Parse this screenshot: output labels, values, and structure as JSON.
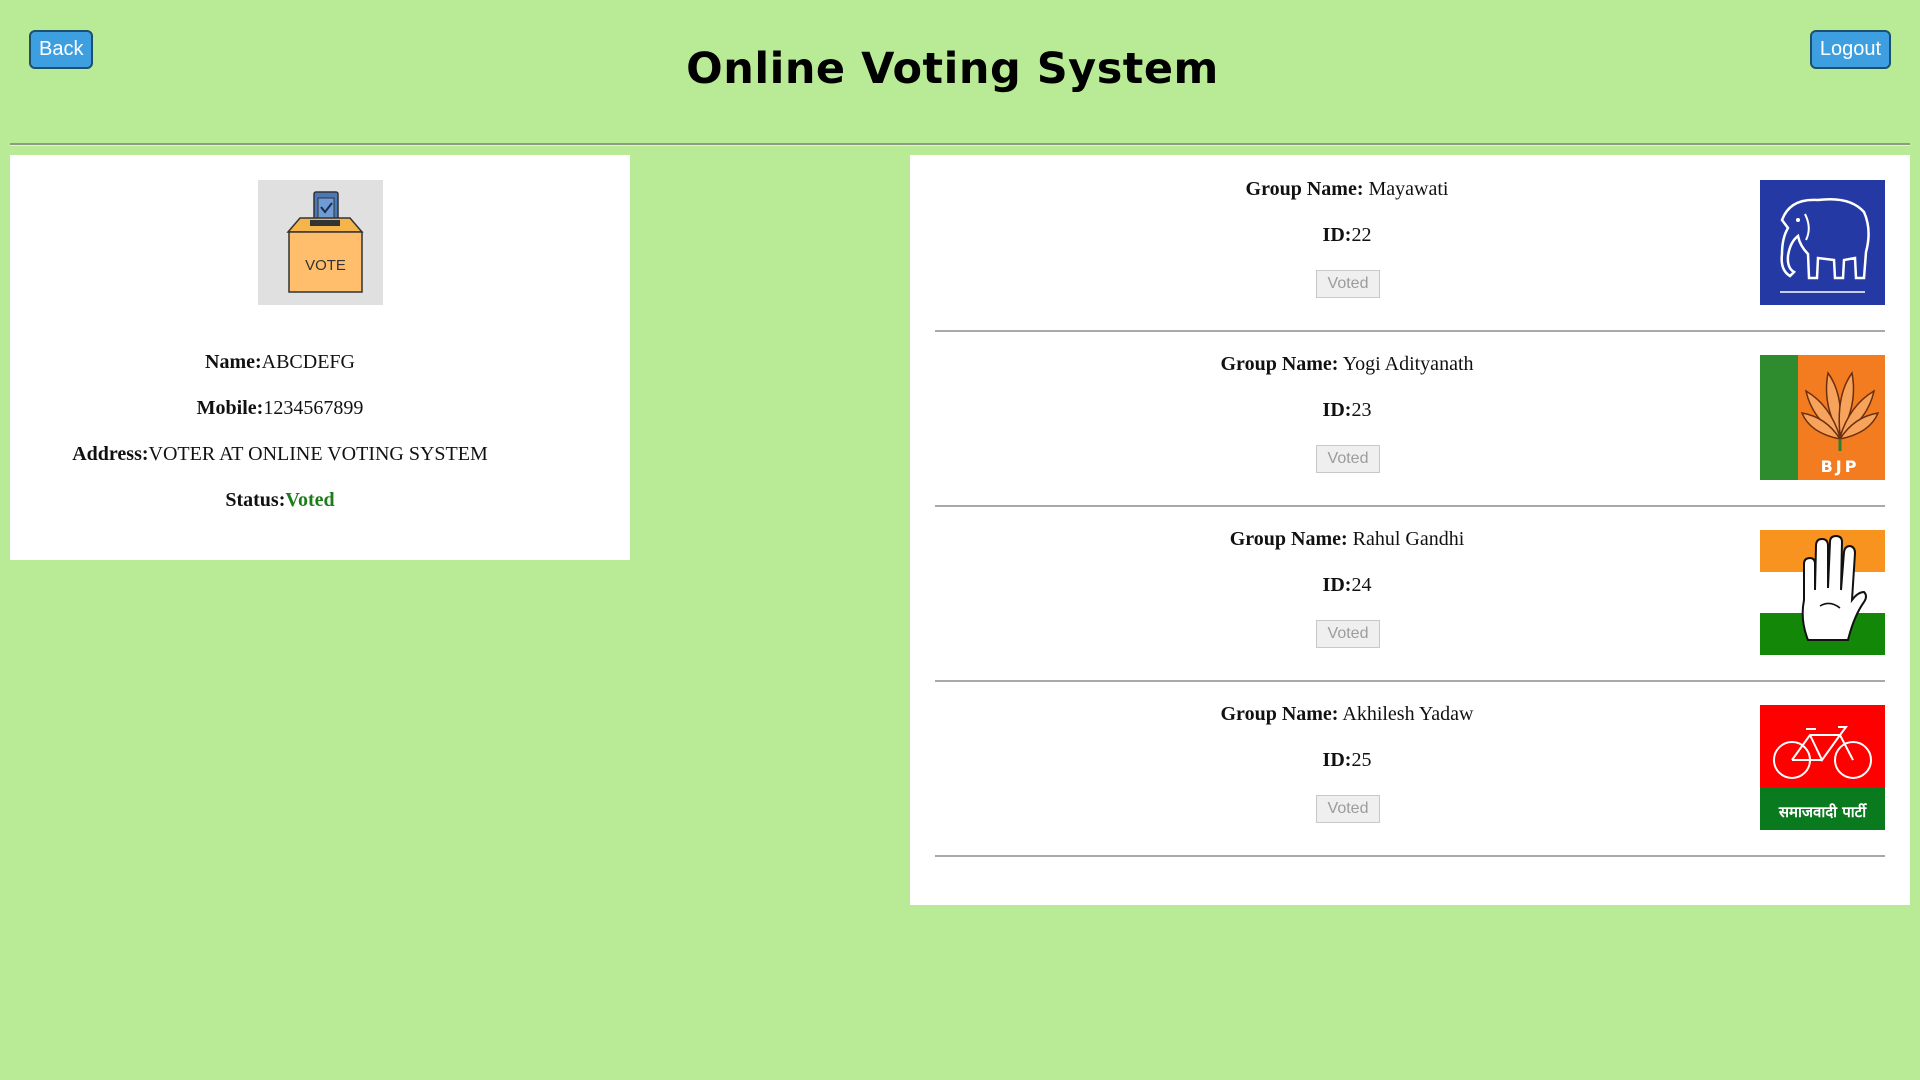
{
  "header": {
    "back_label": "Back",
    "logout_label": "Logout",
    "title": "Online Voting System"
  },
  "profile": {
    "image_text": "VOTE",
    "name_label": "Name:",
    "name_value": "ABCDEFG",
    "mobile_label": "Mobile:",
    "mobile_value": "1234567899",
    "address_label": "Address:",
    "address_value": "VOTER AT ONLINE VOTING SYSTEM",
    "status_label": "Status:",
    "status_value": "Voted"
  },
  "groups": [
    {
      "name_label": "Group Name:",
      "name": "Mayawati",
      "id_label": "ID:",
      "id": "22",
      "button": "Voted",
      "logo": "elephant-icon"
    },
    {
      "name_label": "Group Name:",
      "name": "Yogi Adityanath",
      "id_label": "ID:",
      "id": "23",
      "button": "Voted",
      "logo": "lotus-icon",
      "logo_text": "BJP"
    },
    {
      "name_label": "Group Name:",
      "name": "Rahul Gandhi",
      "id_label": "ID:",
      "id": "24",
      "button": "Voted",
      "logo": "hand-icon"
    },
    {
      "name_label": "Group Name:",
      "name": "Akhilesh Yadaw",
      "id_label": "ID:",
      "id": "25",
      "button": "Voted",
      "logo": "bicycle-icon",
      "logo_text": "समाजवादी पार्टी"
    }
  ],
  "colors": {
    "background": "#b9eb96",
    "button": "#3d9fe0",
    "status": "#1d7d1d"
  }
}
